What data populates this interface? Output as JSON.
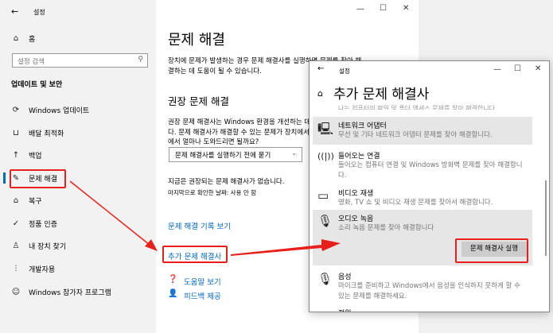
{
  "back_window": {
    "title": "설정",
    "controls": {
      "minimize": "—",
      "maximize": "☐",
      "close": "✕"
    },
    "sidebar": {
      "home": "홈",
      "search_placeholder": "설정 검색",
      "section": "업데이트 및 보안",
      "items": [
        {
          "label": "Windows 업데이트",
          "icon": "sync-icon"
        },
        {
          "label": "배달 최적화",
          "icon": "delivery-icon"
        },
        {
          "label": "백업",
          "icon": "backup-icon"
        },
        {
          "label": "문제 해결",
          "icon": "wrench-icon",
          "selected": true
        },
        {
          "label": "복구",
          "icon": "recovery-icon"
        },
        {
          "label": "정품 인증",
          "icon": "check-circle-icon"
        },
        {
          "label": "내 장치 찾기",
          "icon": "find-device-icon"
        },
        {
          "label": "개발자용",
          "icon": "developer-icon"
        },
        {
          "label": "Windows 참가자 프로그램",
          "icon": "insider-icon"
        }
      ]
    },
    "main": {
      "title": "문제 해결",
      "intro_line1": "장치에 문제가 발생하는 경우 문제 해결사를 실행하면 문제를 찾아 해",
      "intro_line2": "결하는 데 도움이 될 수 있습니다.",
      "recommended_title": "권장 문제 해결",
      "rec_line1": "권장 문제 해결사는 Windows 환경을 개선하는 데 도움이 됩니",
      "rec_line2": "다. 문제 해결사가 해결할 수 있는 문제가 장치에서 발견되면",
      "rec_line3": "에서 얼마나 도와드리면 될까요?",
      "dropdown_value": "문제 해결사를 실행하기 전에 묻기",
      "none_text": "지금은 권장되는 문제 해결사가 없습니다.",
      "last_checked": "마지막으로 확인한 날짜: 사용 안 함",
      "history_link": "문제 해결 기록 보기",
      "additional_link": "추가 문제 해결사",
      "help_link": "도움말 보기",
      "feedback_link": "피드백 제공"
    }
  },
  "front_window": {
    "title": "설정",
    "controls": {
      "minimize": "—",
      "maximize": "☐",
      "close": "✕"
    },
    "page_title": "추가 문제 해결사",
    "partial_top": "나는 컴퓨터의 파일 및 폴더 액세스 문제를 찾아 해결합니다.",
    "items": [
      {
        "title": "네트워크 어댑터",
        "desc": "무선 및 기타 네트워크 어댑터 문제를 찾아 해결합니다."
      },
      {
        "title": "들어오는 연결",
        "desc": "들어오는 컴퓨터 연결 및 Windows 방화벽 문제를 찾아 해결합니다."
      },
      {
        "title": "비디오 재생",
        "desc": "영화, TV 쇼 및 비디오 재생 문제를 찾아서 해결합니다."
      },
      {
        "title": "오디오 녹음",
        "desc": "소리 녹음 문제를 찾아 해결합니다",
        "button": "문제 해결사 실행"
      },
      {
        "title": "음성",
        "desc": "마이크를 준비하고 Windows에서 음성을 인식하지 못하게 할 수 있는 문제를 해결하세요."
      },
      {
        "title": "전원",
        "desc": ""
      }
    ]
  },
  "accent": "#0067c0",
  "highlight": "#e8201c"
}
